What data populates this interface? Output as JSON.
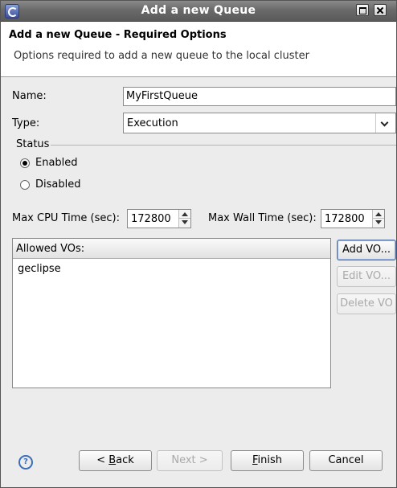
{
  "window": {
    "title": "Add a new Queue"
  },
  "header": {
    "title": "Add a new Queue - Required Options",
    "description": "Options required to add a new queue to the local cluster"
  },
  "form": {
    "name_label": "Name:",
    "name_value": "MyFirstQueue",
    "type_label": "Type:",
    "type_value": "Execution",
    "status_group": "Status",
    "status_options": [
      {
        "label": "Enabled",
        "checked": true
      },
      {
        "label": "Disabled",
        "checked": false
      }
    ],
    "max_cpu_label": "Max CPU Time (sec):",
    "max_cpu_value": "172800",
    "max_wall_label": "Max Wall Time (sec):",
    "max_wall_value": "172800"
  },
  "vos": {
    "header": "Allowed VOs:",
    "rows": [
      "geclipse"
    ],
    "add_label": "Add VO...",
    "edit_label": "Edit VO...",
    "delete_label": "Delete VO"
  },
  "footer": {
    "back_prefix": "< ",
    "back_mnemonic": "B",
    "back_rest": "ack",
    "next_label": "Next >",
    "finish_mnemonic": "F",
    "finish_rest": "inish",
    "cancel_label": "Cancel"
  },
  "icons": {
    "app": "eclipse-icon",
    "help": "help-icon"
  }
}
